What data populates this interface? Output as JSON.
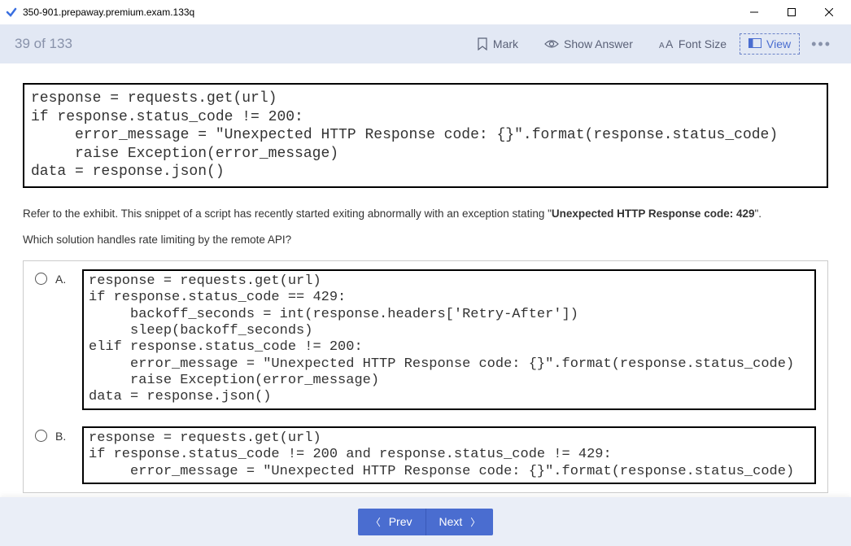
{
  "window": {
    "title": "350-901.prepaway.premium.exam.133q"
  },
  "toolbar": {
    "counter": "39 of 133",
    "mark": "Mark",
    "show_answer": "Show Answer",
    "font_size": "Font Size",
    "view": "View"
  },
  "exhibit_code": "response = requests.get(url)\nif response.status_code != 200:\n     error_message = \"Unexpected HTTP Response code: {}\".format(response.status_code)\n     raise Exception(error_message)\ndata = response.json()",
  "question": {
    "part1": "Refer to the exhibit. This snippet of a script has recently started exiting abnormally with an exception stating \"",
    "bold": "Unexpected HTTP Response code: 429",
    "part2": "\".",
    "line2": "Which solution handles rate limiting by the remote API?"
  },
  "options": {
    "a": {
      "label": "A.",
      "code": "response = requests.get(url)\nif response.status_code == 429:\n     backoff_seconds = int(response.headers['Retry-After'])\n     sleep(backoff_seconds)\nelif response.status_code != 200:\n     error_message = \"Unexpected HTTP Response code: {}\".format(response.status_code)\n     raise Exception(error_message)\ndata = response.json()"
    },
    "b": {
      "label": "B.",
      "code": "response = requests.get(url)\nif response.status_code != 200 and response.status_code != 429:\n     error_message = \"Unexpected HTTP Response code: {}\".format(response.status_code)"
    }
  },
  "footer": {
    "prev": "Prev",
    "next": "Next"
  }
}
